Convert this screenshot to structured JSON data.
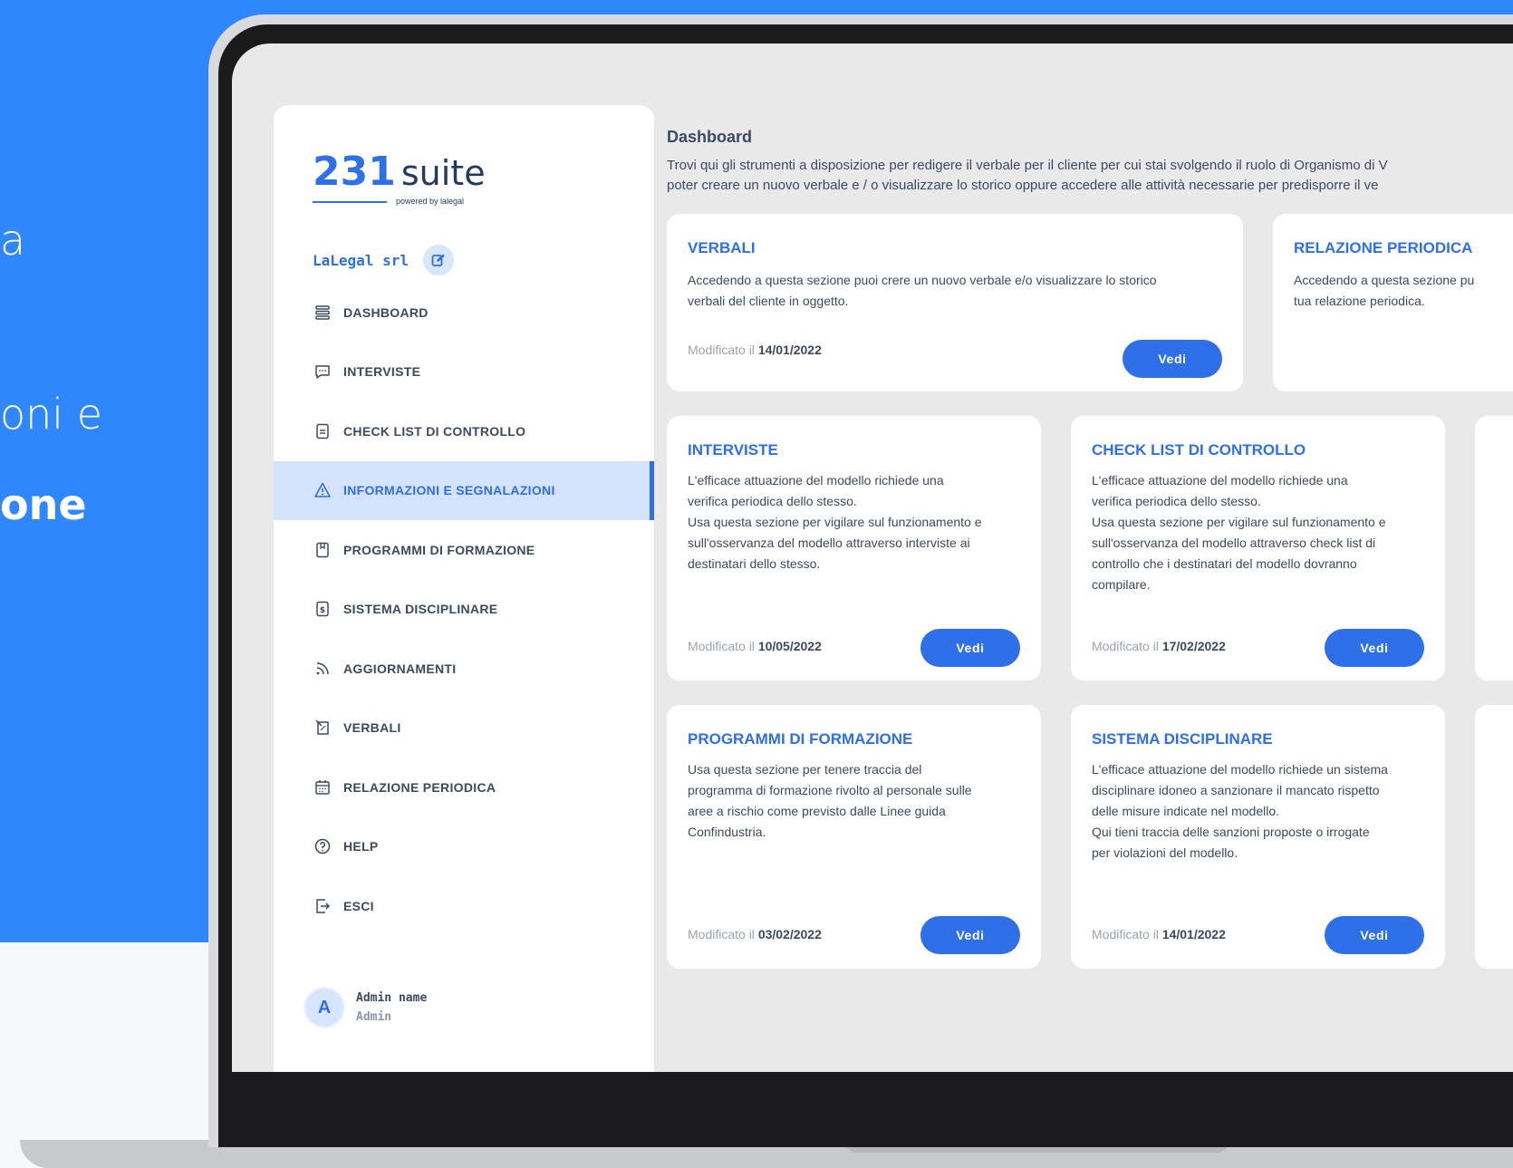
{
  "promo": {
    "line1": "a",
    "line2": "oni e",
    "line3": "one"
  },
  "logo": {
    "number": "231",
    "word": "suite",
    "subtitle": "powered by lalegal"
  },
  "company": {
    "name": "LaLegal srl"
  },
  "menu": [
    {
      "label": "DASHBOARD",
      "icon": "list-icon"
    },
    {
      "label": "INTERVISTE",
      "icon": "chat-icon"
    },
    {
      "label": "CHECK LIST DI CONTROLLO",
      "icon": "document-icon"
    },
    {
      "label": "INFORMAZIONI E SEGNALAZIONI",
      "icon": "warning-icon",
      "active": true
    },
    {
      "label": "PROGRAMMI DI FORMAZIONE",
      "icon": "bookmark-icon"
    },
    {
      "label": "SISTEMA DISCIPLINARE",
      "icon": "dollar-document-icon"
    },
    {
      "label": "AGGIORNAMENTI",
      "icon": "rss-icon"
    },
    {
      "label": "VERBALI",
      "icon": "note-icon"
    },
    {
      "label": "RELAZIONE PERIODICA",
      "icon": "calendar-icon"
    },
    {
      "label": "HELP",
      "icon": "help-icon"
    },
    {
      "label": "ESCI",
      "icon": "logout-icon"
    }
  ],
  "admin": {
    "initial": "A",
    "name": "Admin name",
    "role": "Admin"
  },
  "main": {
    "title": "Dashboard",
    "description": "Trovi qui gli strumenti a disposizione per redigere il verbale per il cliente per cui stai svolgendo il ruolo di Organismo di V\npoter creare un nuovo verbale e / o visualizzare lo storico oppure accedere alle attività necessarie per predisporre il ve"
  },
  "cards": [
    {
      "title": "VERBALI",
      "body": "Accedendo a questa sezione puoi crere un nuovo verbale e/o visualizzare lo storico\nverbali del cliente in oggetto.",
      "modified_label": "Modificato il",
      "modified_date": "14/01/2022",
      "button": "Vedi"
    },
    {
      "title": "RELAZIONE PERIODICA",
      "body": "Accedendo a questa sezione pu\ntua relazione periodica.",
      "modified_label": "",
      "modified_date": "",
      "button": ""
    },
    {
      "title": "INTERVISTE",
      "body": "L'efficace attuazione del modello richiede una\nverifica periodica dello stesso.\nUsa questa sezione per vigilare sul funzionamento e\nsull'osservanza del modello attraverso interviste ai\ndestinatari dello stesso.",
      "modified_label": "Modificato il",
      "modified_date": "10/05/2022",
      "button": "Vedi"
    },
    {
      "title": "CHECK LIST DI CONTROLLO",
      "body": "L'efficace attuazione del modello richiede una\nverifica periodica dello stesso.\nUsa questa sezione per vigilare sul funzionamento e\nsull'osservanza del modello attraverso check list di\ncontrollo che i destinatari del modello dovranno\ncompilare.",
      "modified_label": "Modificato il",
      "modified_date": "17/02/2022",
      "button": "Vedi"
    },
    {
      "title": "PROGRAMMI DI FORMAZIONE",
      "body": "Usa questa sezione per tenere traccia del\nprogramma di formazione rivolto al personale sulle\naree a rischio come previsto dalle Linee guida\nConfindustria.",
      "modified_label": "Modificato il",
      "modified_date": "03/02/2022",
      "button": "Vedi"
    },
    {
      "title": "SISTEMA DISCIPLINARE",
      "body": "L'efficace attuazione del modello richiede un sistema\ndisciplinare idoneo a sanzionare il mancato rispetto\ndelle misure indicate nel modello.\nQui tieni traccia delle sanzioni proposte o irrogate\nper violazioni del modello.",
      "modified_label": "Modificato il",
      "modified_date": "14/01/2022",
      "button": "Vedi"
    }
  ],
  "colors": {
    "brand_blue": "#2f6fe8",
    "background_blue": "#2f87fb",
    "text_dark": "#3b4a63",
    "active_bg": "#d4e3fb"
  }
}
